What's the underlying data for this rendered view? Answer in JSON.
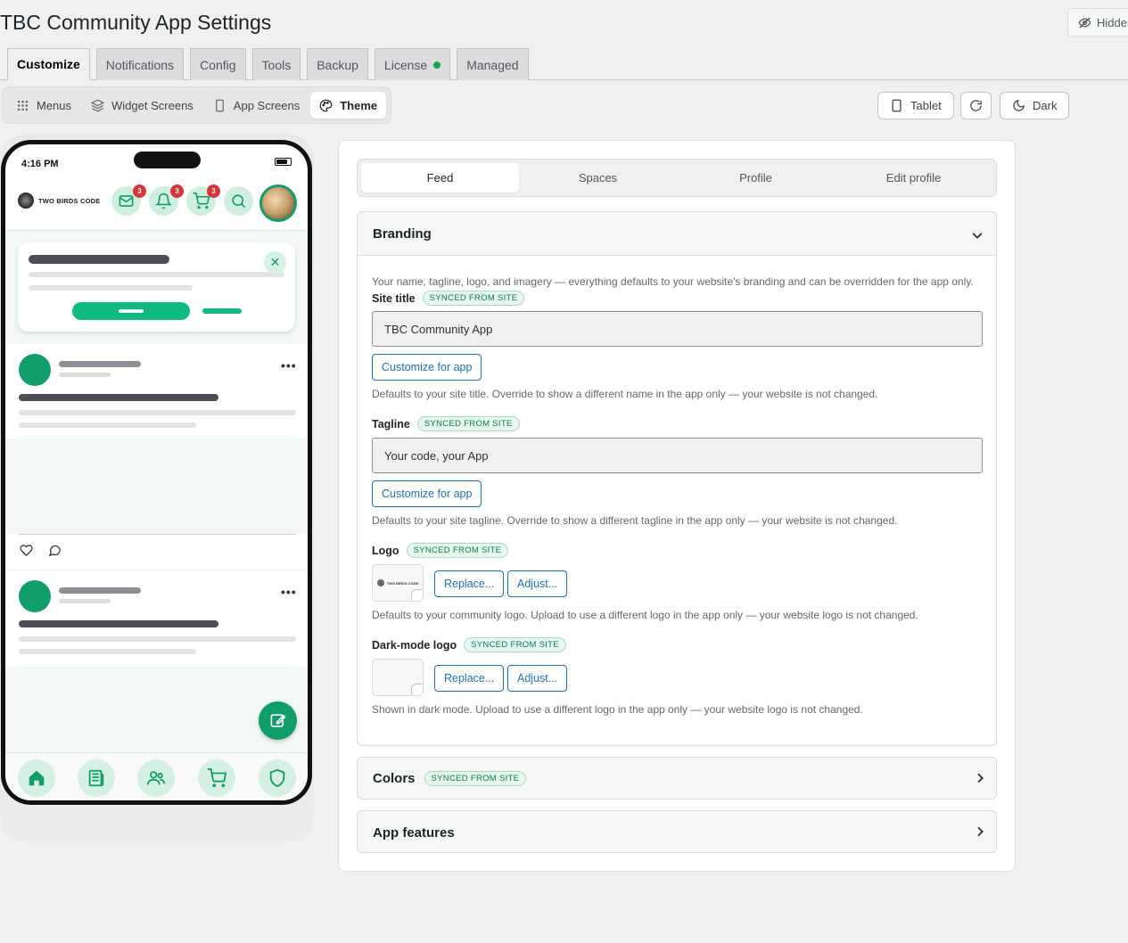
{
  "page": {
    "title": "TBC Community App Settings",
    "hidden_label": "Hidden"
  },
  "tabs": [
    {
      "label": "Customize",
      "active": true
    },
    {
      "label": "Notifications"
    },
    {
      "label": "Config"
    },
    {
      "label": "Tools"
    },
    {
      "label": "Backup"
    },
    {
      "label": "License",
      "status_dot": true
    },
    {
      "label": "Managed"
    }
  ],
  "subtabs": [
    {
      "label": "Menus",
      "icon": "grid-icon"
    },
    {
      "label": "Widget Screens",
      "icon": "layers-icon"
    },
    {
      "label": "App Screens",
      "icon": "phone-icon"
    },
    {
      "label": "Theme",
      "icon": "palette-icon",
      "active": true
    }
  ],
  "toolbar": {
    "tablet_label": "Tablet",
    "dark_label": "Dark"
  },
  "phone": {
    "time": "4:16 PM",
    "brand": "TWO BIRDS CODE",
    "badges": {
      "messages": "3",
      "notifications": "3",
      "cart": "3"
    }
  },
  "feed_tabs": [
    "Feed",
    "Spaces",
    "Profile",
    "Edit profile"
  ],
  "branding": {
    "title": "Branding",
    "intro": "Your name, tagline, logo, and imagery — everything defaults to your website's branding and can be overridden for the app only.",
    "synced_label": "SYNCED FROM SITE",
    "site_title": {
      "label": "Site title",
      "value": "TBC Community App",
      "button": "Customize for app",
      "help": "Defaults to your site title. Override to show a different name in the app only — your website is not changed."
    },
    "tagline": {
      "label": "Tagline",
      "value": "Your code, your App",
      "button": "Customize for app",
      "help": "Defaults to your site tagline. Override to show a different tagline in the app only — your website is not changed."
    },
    "logo": {
      "label": "Logo",
      "replace": "Replace...",
      "adjust": "Adjust...",
      "help": "Defaults to your community logo. Upload to use a different logo in the app only — your website logo is not changed.",
      "preview_text": "TWO BIRDS CODE"
    },
    "dark_logo": {
      "label": "Dark-mode logo",
      "replace": "Replace...",
      "adjust": "Adjust...",
      "help": "Shown in dark mode. Upload to use a different logo in the app only — your website logo is not changed."
    }
  },
  "colors_section": {
    "title": "Colors",
    "synced_label": "SYNCED FROM SITE"
  },
  "features_section": {
    "title": "App features"
  },
  "colors": {
    "accent": "#0f9d6a",
    "link": "#2271b1",
    "badge": "#d63638"
  }
}
